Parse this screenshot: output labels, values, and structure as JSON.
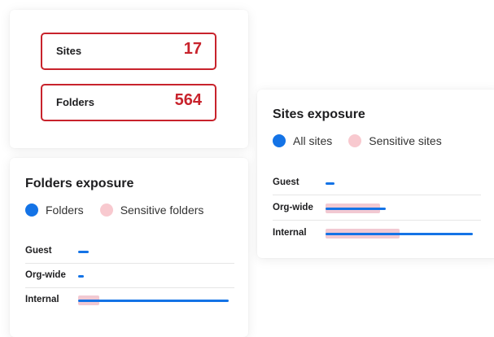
{
  "summary": {
    "stats": [
      {
        "label": "Sites",
        "value": "17"
      },
      {
        "label": "Folders",
        "value": "564"
      }
    ]
  },
  "folders_exposure": {
    "title": "Folders exposure",
    "legend": {
      "primary": "Folders",
      "secondary": "Sensitive folders"
    },
    "rows": [
      {
        "label": "Guest",
        "total_fraction": 0.07,
        "sensitive_fraction": 0.0
      },
      {
        "label": "Org-wide",
        "total_fraction": 0.04,
        "sensitive_fraction": 0.0
      },
      {
        "label": "Internal",
        "total_fraction": 1.0,
        "sensitive_fraction": 0.14
      }
    ]
  },
  "sites_exposure": {
    "title": "Sites exposure",
    "legend": {
      "primary": "All sites",
      "secondary": "Sensitive sites"
    },
    "rows": [
      {
        "label": "Guest",
        "total_fraction": 0.06,
        "sensitive_fraction": 0.0
      },
      {
        "label": "Org-wide",
        "total_fraction": 0.41,
        "sensitive_fraction": 0.37
      },
      {
        "label": "Internal",
        "total_fraction": 1.0,
        "sensitive_fraction": 0.5
      }
    ]
  },
  "colors": {
    "accent_red": "#c8232c",
    "bar_blue": "#1473e6",
    "bar_pink": "#f2c9d2"
  }
}
